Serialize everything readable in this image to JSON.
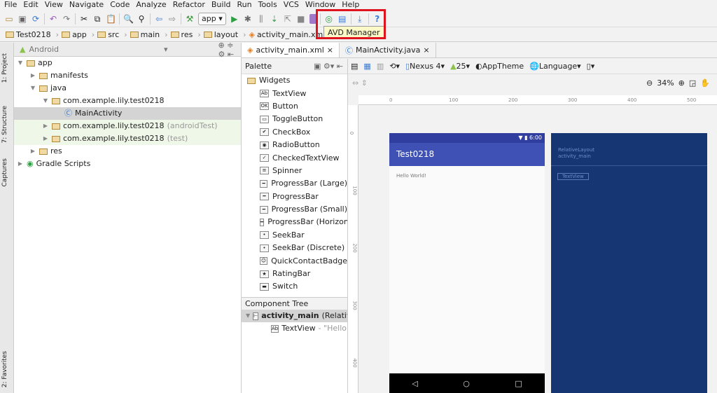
{
  "menu": [
    "File",
    "Edit",
    "View",
    "Navigate",
    "Code",
    "Analyze",
    "Refactor",
    "Build",
    "Run",
    "Tools",
    "VCS",
    "Window",
    "Help"
  ],
  "toolbar": {
    "run_config": "app",
    "tooltip": "AVD Manager"
  },
  "breadcrumbs": [
    "Test0218",
    "app",
    "src",
    "main",
    "res",
    "layout",
    "activity_main.xml"
  ],
  "side_tabs": [
    "1: Project",
    "7: Structure",
    "Captures",
    "2: Favorites"
  ],
  "project": {
    "view": "Android",
    "tree": [
      {
        "label": "app",
        "depth": 0,
        "open": true
      },
      {
        "label": "manifests",
        "depth": 1,
        "open": false
      },
      {
        "label": "java",
        "depth": 1,
        "open": true
      },
      {
        "label": "com.example.lily.test0218",
        "depth": 2,
        "open": true
      },
      {
        "label": "MainActivity",
        "depth": 3,
        "selected": true
      },
      {
        "label": "com.example.lily.test0218",
        "suffix": "(androidTest)",
        "depth": 2,
        "open": false
      },
      {
        "label": "com.example.lily.test0218",
        "suffix": "(test)",
        "depth": 2,
        "open": false
      },
      {
        "label": "res",
        "depth": 1,
        "open": false
      },
      {
        "label": "Gradle Scripts",
        "depth": 0,
        "open": false
      }
    ]
  },
  "editor_tabs": [
    "activity_main.xml",
    "MainActivity.java"
  ],
  "palette": {
    "title": "Palette",
    "group": "Widgets",
    "items": [
      {
        "icon": "Ab",
        "label": "TextView"
      },
      {
        "icon": "OK",
        "label": "Button"
      },
      {
        "icon": "▭",
        "label": "ToggleButton"
      },
      {
        "icon": "✔",
        "label": "CheckBox"
      },
      {
        "icon": "◉",
        "label": "RadioButton"
      },
      {
        "icon": "✓",
        "label": "CheckedTextView"
      },
      {
        "icon": "≡",
        "label": "Spinner"
      },
      {
        "icon": "━",
        "label": "ProgressBar (Large)"
      },
      {
        "icon": "━",
        "label": "ProgressBar"
      },
      {
        "icon": "━",
        "label": "ProgressBar (Small)"
      },
      {
        "icon": "━",
        "label": "ProgressBar (Horizontal)"
      },
      {
        "icon": "•",
        "label": "SeekBar"
      },
      {
        "icon": "•",
        "label": "SeekBar (Discrete)"
      },
      {
        "icon": "☺",
        "label": "QuickContactBadge"
      },
      {
        "icon": "★",
        "label": "RatingBar"
      },
      {
        "icon": "▬",
        "label": "Switch"
      }
    ]
  },
  "component_tree": {
    "title": "Component Tree",
    "root": "activity_main",
    "root_suffix": "(RelativeLayout)",
    "child": "TextView",
    "child_suffix": "- \"Hello World!\""
  },
  "design_toolbar": {
    "device": "Nexus 4",
    "api": "25",
    "theme": "AppTheme",
    "language": "Language",
    "zoom": "34%"
  },
  "ruler": {
    "h": [
      "0",
      "100",
      "200",
      "300",
      "400",
      "500"
    ],
    "v": [
      "0",
      "100",
      "200",
      "300",
      "400"
    ]
  },
  "phone": {
    "time": "6:00",
    "app_title": "Test0218",
    "text": "Hello World!"
  },
  "blueprint": {
    "layout": "RelativeLayout",
    "id": "activity_main",
    "view": "TextView"
  },
  "colors": {
    "accent": "#3f51b5",
    "status": "#303f9f",
    "blueprint": "#163573",
    "highlight": "#e0141e"
  }
}
